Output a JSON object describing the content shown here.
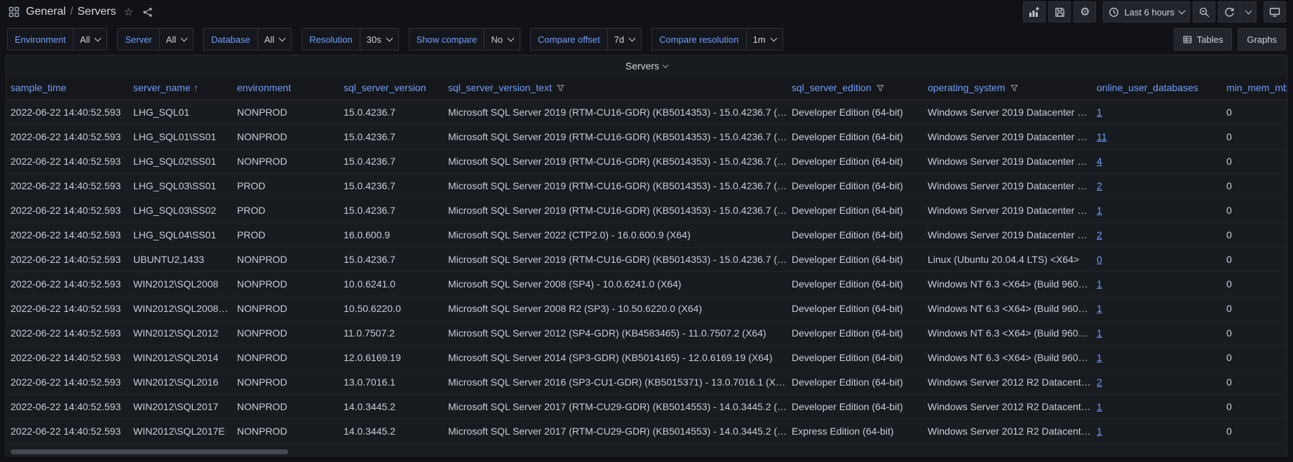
{
  "colors": {
    "page_bg": "#111217",
    "panel_bg": "#181b1f",
    "header_blue": "#6e9fff",
    "link_blue": "#6e9fff",
    "text": "#ccccdc"
  },
  "icons": {
    "apps-icon": "grid-2x2",
    "star-icon": "☆",
    "share-icon": "share-nodes",
    "add-panel-icon": "chart-plus",
    "save-icon": "floppy",
    "settings-icon": "⚙",
    "clock-icon": "clock",
    "chevron-down-icon": "⌄",
    "zoom-out-icon": "magnifier-minus",
    "refresh-icon": "circular-arrow",
    "tv-icon": "monitor",
    "table-icon": "table-grid",
    "sort-asc-icon": "↑",
    "filter-funnel-icon": "funnel"
  },
  "topnav": {
    "breadcrumb": {
      "folder": "General",
      "separator": "/",
      "dashboard": "Servers"
    },
    "time_picker": {
      "label": "Last 6 hours"
    }
  },
  "filter_bar": {
    "filters": [
      {
        "label": "Environment",
        "value": "All"
      },
      {
        "label": "Server",
        "value": "All"
      },
      {
        "label": "Database",
        "value": "All"
      },
      {
        "label": "Resolution",
        "value": "30s"
      },
      {
        "label": "Show compare",
        "value": "No"
      },
      {
        "label": "Compare offset",
        "value": "7d"
      },
      {
        "label": "Compare resolution",
        "value": "1m"
      }
    ],
    "view_buttons": [
      {
        "label": "Tables",
        "icon": "table-icon"
      },
      {
        "label": "Graphs"
      }
    ]
  },
  "panel": {
    "title": "Servers"
  },
  "table": {
    "columns": [
      {
        "key": "sample_time",
        "label": "sample_time"
      },
      {
        "key": "server_name",
        "label": "server_name",
        "sort": "asc"
      },
      {
        "key": "environment",
        "label": "environment"
      },
      {
        "key": "sql_server_version",
        "label": "sql_server_version"
      },
      {
        "key": "sql_server_version_text",
        "label": "sql_server_version_text",
        "filter": true
      },
      {
        "key": "sql_server_edition",
        "label": "sql_server_edition",
        "filter": true
      },
      {
        "key": "operating_system",
        "label": "operating_system",
        "filter": true
      },
      {
        "key": "online_user_databases",
        "label": "online_user_databases",
        "link": true
      },
      {
        "key": "min_mem_mb",
        "label": "min_mem_mb"
      }
    ],
    "rows": [
      {
        "sample_time": "2022-06-22 14:40:52.593",
        "server_name": "LHG_SQL01",
        "environment": "NONPROD",
        "sql_server_version": "15.0.4236.7",
        "sql_server_version_text": "Microsoft SQL Server 2019 (RTM-CU16-GDR) (KB5014353) - 15.0.4236.7 (…",
        "sql_server_edition": "Developer Edition (64-bit)",
        "operating_system": "Windows Server 2019 Datacenter …",
        "online_user_databases": "1",
        "min_mem_mb": "0"
      },
      {
        "sample_time": "2022-06-22 14:40:52.593",
        "server_name": "LHG_SQL01\\SS01",
        "environment": "NONPROD",
        "sql_server_version": "15.0.4236.7",
        "sql_server_version_text": "Microsoft SQL Server 2019 (RTM-CU16-GDR) (KB5014353) - 15.0.4236.7 (…",
        "sql_server_edition": "Developer Edition (64-bit)",
        "operating_system": "Windows Server 2019 Datacenter …",
        "online_user_databases": "11",
        "min_mem_mb": "0"
      },
      {
        "sample_time": "2022-06-22 14:40:52.593",
        "server_name": "LHG_SQL02\\SS01",
        "environment": "NONPROD",
        "sql_server_version": "15.0.4236.7",
        "sql_server_version_text": "Microsoft SQL Server 2019 (RTM-CU16-GDR) (KB5014353) - 15.0.4236.7 (…",
        "sql_server_edition": "Developer Edition (64-bit)",
        "operating_system": "Windows Server 2019 Datacenter …",
        "online_user_databases": "4",
        "min_mem_mb": "0"
      },
      {
        "sample_time": "2022-06-22 14:40:52.593",
        "server_name": "LHG_SQL03\\SS01",
        "environment": "PROD",
        "sql_server_version": "15.0.4236.7",
        "sql_server_version_text": "Microsoft SQL Server 2019 (RTM-CU16-GDR) (KB5014353) - 15.0.4236.7 (…",
        "sql_server_edition": "Developer Edition (64-bit)",
        "operating_system": "Windows Server 2019 Datacenter …",
        "online_user_databases": "2",
        "min_mem_mb": "0"
      },
      {
        "sample_time": "2022-06-22 14:40:52.593",
        "server_name": "LHG_SQL03\\SS02",
        "environment": "PROD",
        "sql_server_version": "15.0.4236.7",
        "sql_server_version_text": "Microsoft SQL Server 2019 (RTM-CU16-GDR) (KB5014353) - 15.0.4236.7 (…",
        "sql_server_edition": "Developer Edition (64-bit)",
        "operating_system": "Windows Server 2019 Datacenter …",
        "online_user_databases": "1",
        "min_mem_mb": "0"
      },
      {
        "sample_time": "2022-06-22 14:40:52.593",
        "server_name": "LHG_SQL04\\SS01",
        "environment": "PROD",
        "sql_server_version": "16.0.600.9",
        "sql_server_version_text": "Microsoft SQL Server 2022 (CTP2.0) - 16.0.600.9 (X64)",
        "sql_server_edition": "Developer Edition (64-bit)",
        "operating_system": "Windows Server 2019 Datacenter …",
        "online_user_databases": "2",
        "min_mem_mb": "0"
      },
      {
        "sample_time": "2022-06-22 14:40:52.593",
        "server_name": "UBUNTU2,1433",
        "environment": "NONPROD",
        "sql_server_version": "15.0.4236.7",
        "sql_server_version_text": "Microsoft SQL Server 2019 (RTM-CU16-GDR) (KB5014353) - 15.0.4236.7 (…",
        "sql_server_edition": "Developer Edition (64-bit)",
        "operating_system": "Linux (Ubuntu 20.04.4 LTS) <X64>",
        "online_user_databases": "0",
        "min_mem_mb": "0"
      },
      {
        "sample_time": "2022-06-22 14:40:52.593",
        "server_name": "WIN2012\\SQL2008",
        "environment": "NONPROD",
        "sql_server_version": "10.0.6241.0",
        "sql_server_version_text": "Microsoft SQL Server 2008 (SP4) - 10.0.6241.0 (X64)",
        "sql_server_edition": "Developer Edition (64-bit)",
        "operating_system": "Windows NT 6.3 <X64> (Build 960…",
        "online_user_databases": "1",
        "min_mem_mb": "0"
      },
      {
        "sample_time": "2022-06-22 14:40:52.593",
        "server_name": "WIN2012\\SQL2008…",
        "environment": "NONPROD",
        "sql_server_version": "10.50.6220.0",
        "sql_server_version_text": "Microsoft SQL Server 2008 R2 (SP3) - 10.50.6220.0 (X64)",
        "sql_server_edition": "Developer Edition (64-bit)",
        "operating_system": "Windows NT 6.3 <X64> (Build 960…",
        "online_user_databases": "1",
        "min_mem_mb": "0"
      },
      {
        "sample_time": "2022-06-22 14:40:52.593",
        "server_name": "WIN2012\\SQL2012",
        "environment": "NONPROD",
        "sql_server_version": "11.0.7507.2",
        "sql_server_version_text": "Microsoft SQL Server 2012 (SP4-GDR) (KB4583465) - 11.0.7507.2 (X64)",
        "sql_server_edition": "Developer Edition (64-bit)",
        "operating_system": "Windows NT 6.3 <X64> (Build 960…",
        "online_user_databases": "1",
        "min_mem_mb": "0"
      },
      {
        "sample_time": "2022-06-22 14:40:52.593",
        "server_name": "WIN2012\\SQL2014",
        "environment": "NONPROD",
        "sql_server_version": "12.0.6169.19",
        "sql_server_version_text": "Microsoft SQL Server 2014 (SP3-GDR) (KB5014165) - 12.0.6169.19 (X64)",
        "sql_server_edition": "Developer Edition (64-bit)",
        "operating_system": "Windows NT 6.3 <X64> (Build 960…",
        "online_user_databases": "1",
        "min_mem_mb": "0"
      },
      {
        "sample_time": "2022-06-22 14:40:52.593",
        "server_name": "WIN2012\\SQL2016",
        "environment": "NONPROD",
        "sql_server_version": "13.0.7016.1",
        "sql_server_version_text": "Microsoft SQL Server 2016 (SP3-CU1-GDR) (KB5015371) - 13.0.7016.1 (X…",
        "sql_server_edition": "Developer Edition (64-bit)",
        "operating_system": "Windows Server 2012 R2 Datacent…",
        "online_user_databases": "2",
        "min_mem_mb": "0"
      },
      {
        "sample_time": "2022-06-22 14:40:52.593",
        "server_name": "WIN2012\\SQL2017",
        "environment": "NONPROD",
        "sql_server_version": "14.0.3445.2",
        "sql_server_version_text": "Microsoft SQL Server 2017 (RTM-CU29-GDR) (KB5014553) - 14.0.3445.2 (…",
        "sql_server_edition": "Developer Edition (64-bit)",
        "operating_system": "Windows Server 2012 R2 Datacent…",
        "online_user_databases": "1",
        "min_mem_mb": "0"
      },
      {
        "sample_time": "2022-06-22 14:40:52.593",
        "server_name": "WIN2012\\SQL2017E",
        "environment": "NONPROD",
        "sql_server_version": "14.0.3445.2",
        "sql_server_version_text": "Microsoft SQL Server 2017 (RTM-CU29-GDR) (KB5014553) - 14.0.3445.2 (…",
        "sql_server_edition": "Express Edition (64-bit)",
        "operating_system": "Windows Server 2012 R2 Datacent…",
        "online_user_databases": "1",
        "min_mem_mb": "0"
      }
    ]
  }
}
